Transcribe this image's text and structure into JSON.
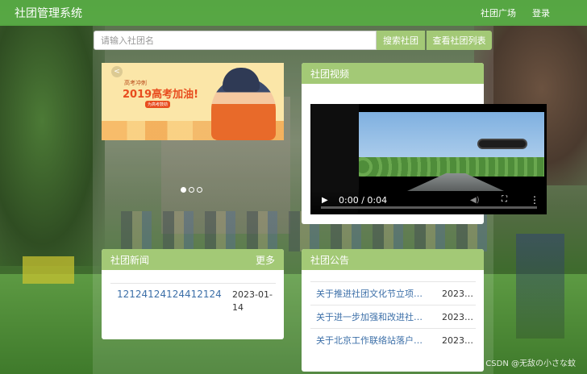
{
  "header": {
    "brand": "社团管理系统",
    "nav": [
      "社团广场",
      "登录"
    ]
  },
  "search": {
    "placeholder": "请输入社团名",
    "value": "",
    "search_button": "搜索社团",
    "list_button": "查看社团列表"
  },
  "carousel": {
    "slide_title": "2019高考加油!",
    "slide_subtitle": "高考冲刺",
    "slide_tag": "为高考鼓劲",
    "slide_count": 3,
    "active_slide": 1
  },
  "video_panel": {
    "title": "社团视频",
    "time": "0:00 / 0:04"
  },
  "news_panel": {
    "title": "社团新闻",
    "more": "更多",
    "items": [
      {
        "title": "12124124124412124",
        "date": "2023-01-14"
      }
    ]
  },
  "notice_panel": {
    "title": "社团公告",
    "items": [
      {
        "title": "关于推进社团文化节立项的通知",
        "date": "2023-0..."
      },
      {
        "title": "关于进一步加强和改进社团工作的通知",
        "date": "2023-0..."
      },
      {
        "title": "关于北京工作联络站落户的通知",
        "date": "2023-0..."
      }
    ]
  },
  "watermark": "CSDN @无敌の小さな蚊",
  "colors": {
    "nav_green": "#5ab446",
    "accent_green": "#a3c976",
    "link_blue": "#3c6fa8"
  }
}
